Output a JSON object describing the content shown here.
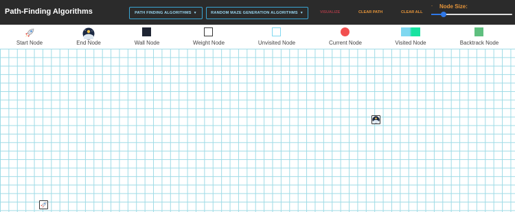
{
  "navbar": {
    "brand": "Path-Finding Algorithms",
    "dropdown_pathfinding": "PATH FINDING ALGORITHMS",
    "dropdown_maze": "RANDOM MAZE GENERATION ALGORITHMS",
    "visualize": "VISUALIZE",
    "clear_path": "CLEAR PATH",
    "clear_all": "CLEAR ALL",
    "slider_minus": "-",
    "node_size_label": "Node Size:",
    "node_size_level": 0.15
  },
  "legend": [
    {
      "label": "Start Node",
      "icon": "rocket-icon"
    },
    {
      "label": "End Node",
      "icon": "planet-icon"
    },
    {
      "label": "Wall Node",
      "icon": "wall-square-icon"
    },
    {
      "label": "Weight Node",
      "icon": "weight-square-icon"
    },
    {
      "label": "Unvisited Node",
      "icon": "unvisited-square-icon"
    },
    {
      "label": "Current Node",
      "icon": "current-circle-icon"
    },
    {
      "label": "Visited Node",
      "icon": "visited-gradient-icon"
    },
    {
      "label": "Backtrack Node",
      "icon": "backtrack-square-icon"
    }
  ],
  "colors": {
    "navbar": "#2b2b2b",
    "accent_blue": "#3aa7d6",
    "visualize": "#a33a45",
    "orange": "#e5943a",
    "grid_line": "#9edbe6",
    "wall": "#1f2533",
    "current": "#f25050",
    "visited_start": "#7fd8f0",
    "visited_end": "#18e3a0",
    "backtrack": "#5fbf7f"
  }
}
